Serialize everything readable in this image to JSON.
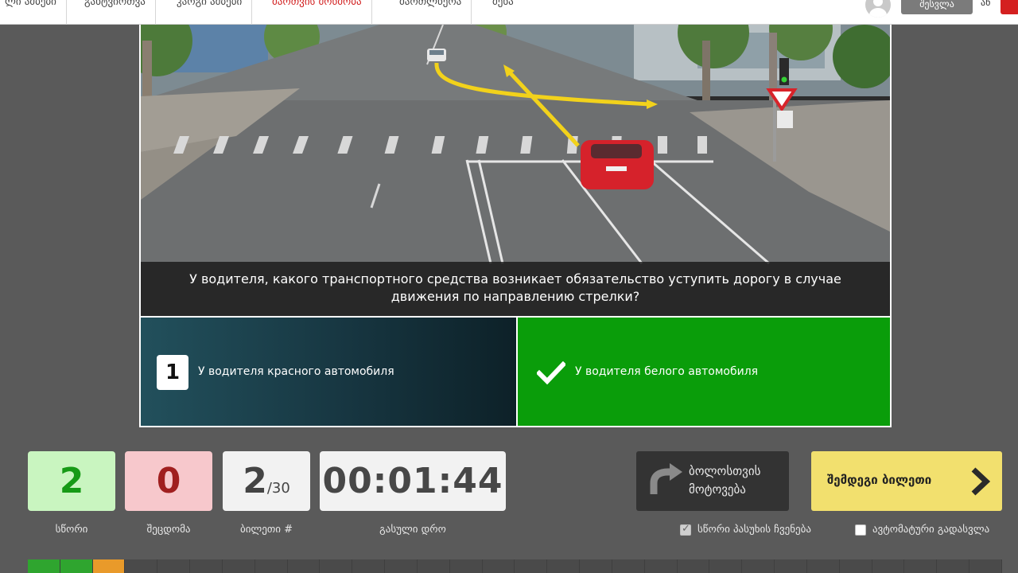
{
  "nav": {
    "items": [
      {
        "label": "ლი ამბები",
        "active": false
      },
      {
        "label": "განტვირთვა",
        "active": false
      },
      {
        "label": "კარგი ამბები",
        "active": false
      },
      {
        "label": "მართვის მოწმობა",
        "active": true
      },
      {
        "label": "მართლწერა",
        "active": false
      },
      {
        "label": "მენა",
        "active": false
      }
    ],
    "avatar_icon": "user-avatar-icon",
    "login_label": "შესვლა",
    "lang_label": "ან"
  },
  "question": {
    "text": "У водителя, какого транспортного средства возникает обязательство уступить дорогу в случае движения по направлению стрелки?"
  },
  "answers": [
    {
      "number": "1",
      "text": "У водителя красного автомобиля",
      "state": "default"
    },
    {
      "number": "",
      "text": "У водителя белого автомобиля",
      "state": "correct",
      "icon": "check-icon"
    }
  ],
  "stats": {
    "correct": {
      "value": "2",
      "label": "სწორი"
    },
    "wrong": {
      "value": "0",
      "label": "შეცდომა"
    },
    "ticket": {
      "value": "2",
      "total": "/30",
      "label": "ბილეთი #"
    },
    "time": {
      "value": "00:01:44",
      "label": "გასული დრო"
    }
  },
  "buttons": {
    "later": {
      "label": "ბოლოსთვის მოტოვება",
      "icon": "return-arrow-icon"
    },
    "next": {
      "label": "შემდეგი ბილეთი",
      "icon": "chevron-right-icon"
    }
  },
  "options": {
    "show_correct": {
      "label": "სწორი პასუხის ჩვენება",
      "checked": true
    },
    "auto_advance": {
      "label": "ავტომატური გადასვლა",
      "checked": false
    }
  },
  "progress": {
    "total_segments": 30,
    "segments": [
      {
        "state": "correct",
        "color": "#2fa52f"
      },
      {
        "state": "correct",
        "color": "#2fa52f"
      },
      {
        "state": "current",
        "color": "#e99a2a"
      }
    ]
  },
  "colors": {
    "accent_green": "#0a9d0a",
    "nav_active": "#d11e1e",
    "next_button": "#f2e06e"
  }
}
